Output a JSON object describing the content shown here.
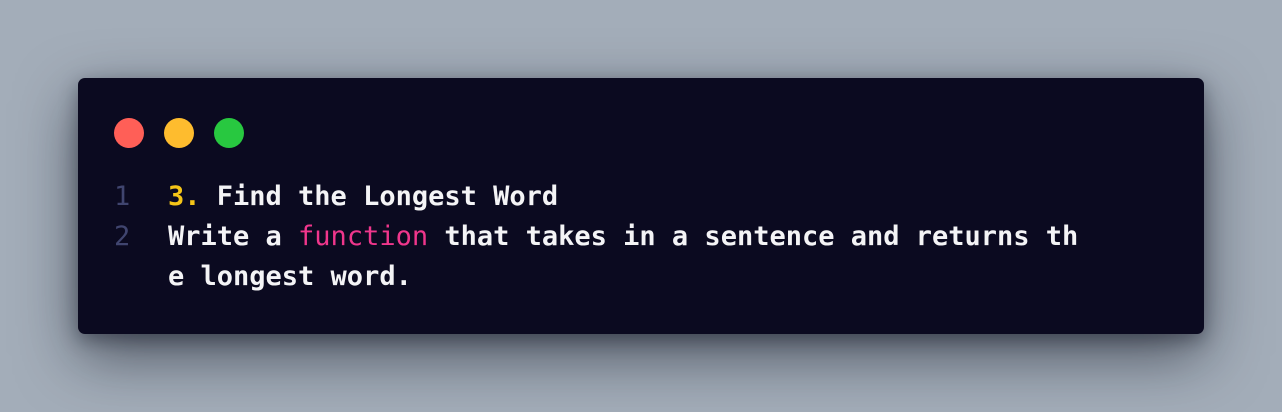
{
  "window_controls": {
    "close_color": "#ff5f57",
    "minimize_color": "#febc2e",
    "maximize_color": "#28c840"
  },
  "colors": {
    "background": "#a3adb9",
    "editor_background": "#0b0a20",
    "line_number": "#40456f",
    "text": "#f4f4f6",
    "number_token": "#f5c518",
    "keyword_token": "#f0368c"
  },
  "code": {
    "line1": {
      "number": "1",
      "prefix": "3.",
      "text": " Find the Longest Word"
    },
    "line2": {
      "number": "2",
      "part1": "Write a ",
      "keyword": "function",
      "part2": " that takes in a sentence and returns th"
    },
    "line2_wrap": {
      "text": "e longest word."
    }
  }
}
